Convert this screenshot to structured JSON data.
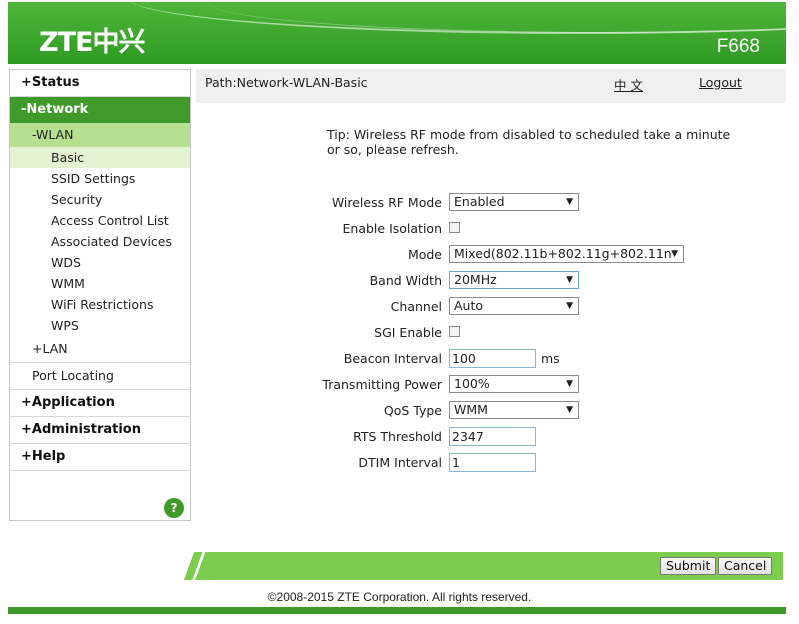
{
  "header": {
    "logo": "ZTE中兴",
    "model": "F668"
  },
  "nav": {
    "status": {
      "sign": "+",
      "label": "Status"
    },
    "network": {
      "sign": "-",
      "label": "Network"
    },
    "wlan": {
      "sign": "-",
      "label": "WLAN"
    },
    "wlan_items": [
      "Basic",
      "SSID Settings",
      "Security",
      "Access Control List",
      "Associated Devices",
      "WDS",
      "WMM",
      "WiFi Restrictions",
      "WPS"
    ],
    "lan": {
      "sign": "+",
      "label": "LAN"
    },
    "port_locating": "Port Locating",
    "application": {
      "sign": "+",
      "label": "Application"
    },
    "administration": {
      "sign": "+",
      "label": "Administration"
    },
    "help": {
      "sign": "+",
      "label": "Help"
    },
    "help_icon": "?"
  },
  "pathbar": {
    "path": "Path:Network-WLAN-Basic",
    "language": "中 文",
    "logout": "Logout"
  },
  "tip": "Tip: Wireless RF mode from disabled to scheduled take a minute or so, please refresh.",
  "form": {
    "rf_mode": {
      "label": "Wireless RF Mode",
      "value": "Enabled"
    },
    "isolation": {
      "label": "Enable Isolation"
    },
    "mode": {
      "label": "Mode",
      "value": "Mixed(802.11b+802.11g+802.11n"
    },
    "bandwidth": {
      "label": "Band Width",
      "value": "20MHz"
    },
    "channel": {
      "label": "Channel",
      "value": "Auto"
    },
    "sgi": {
      "label": "SGI Enable"
    },
    "beacon": {
      "label": "Beacon Interval",
      "value": "100",
      "unit": "ms"
    },
    "tx_power": {
      "label": "Transmitting Power",
      "value": "100%"
    },
    "qos": {
      "label": "QoS Type",
      "value": "WMM"
    },
    "rts": {
      "label": "RTS Threshold",
      "value": "2347"
    },
    "dtim": {
      "label": "DTIM Interval",
      "value": "1"
    }
  },
  "buttons": {
    "submit": "Submit",
    "cancel": "Cancel"
  },
  "footer": {
    "copyright": "©2008-2015 ZTE Corporation. All rights reserved."
  },
  "icons": {
    "dropdown": "triangle-down",
    "help": "question-circle"
  },
  "colors": {
    "brand_green": "#3f9a2a",
    "band_green": "#7ccc4d",
    "wlan_highlight": "#b6e08f",
    "basic_highlight": "#e3f3d1"
  }
}
